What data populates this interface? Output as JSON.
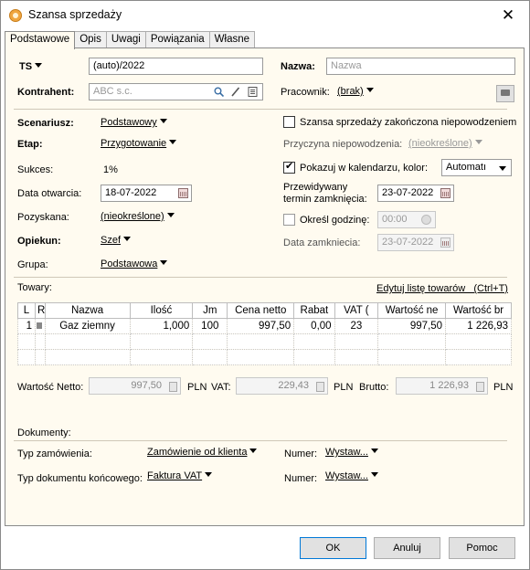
{
  "window": {
    "title": "Szansa sprzedaży",
    "close": "✕"
  },
  "tabs": [
    "Podstawowe",
    "Opis",
    "Uwagi",
    "Powiązania",
    "Własne"
  ],
  "header": {
    "ts_label": "TS",
    "ts_value": "(auto)/2022",
    "nazwa_label": "Nazwa:",
    "nazwa_placeholder": "Nazwa",
    "kontrahent_label": "Kontrahent:",
    "kontrahent_placeholder": "ABC s.c.",
    "pracownik_label": "Pracownik:",
    "pracownik_value": "(brak)"
  },
  "left": {
    "scenariusz_label": "Scenariusz:",
    "scenariusz_value": "Podstawowy",
    "etap_label": "Etap:",
    "etap_value": "Przygotowanie",
    "sukces_label": "Sukces:",
    "sukces_value": "1%",
    "data_otwarcia_label": "Data otwarcia:",
    "data_otwarcia_value": "18-07-2022",
    "pozyskana_label": "Pozyskana:",
    "pozyskana_value": "(nieokreślone)",
    "opiekun_label": "Opiekun:",
    "opiekun_value": "Szef",
    "grupa_label": "Grupa:",
    "grupa_value": "Podstawowa"
  },
  "right": {
    "zakonczona_label": "Szansa sprzedaży zakończona niepowodzeniem",
    "przyczyna_label": "Przyczyna niepowodzenia:",
    "przyczyna_value": "(nieokreślone)",
    "kalendarz_label": "Pokazuj w kalendarzu, kolor:",
    "kolor_value": "Automatı",
    "przewidywany_label_1": "Przewidywany",
    "przewidywany_label_2": "termin zamknięcia:",
    "przewidywany_value": "23-07-2022",
    "godzine_label": "Określ godzinę:",
    "godzine_value": "00:00",
    "data_zamkniecia_label": "Data zamkniecia:",
    "data_zamkniecia_value": "23-07-2022"
  },
  "towary": {
    "label": "Towary:",
    "edit_link": "Edytuj listę towarów   (Ctrl+T)",
    "columns": [
      "L",
      "R",
      "Nazwa",
      "Ilość",
      "Jm",
      "Cena netto",
      "Rabat",
      "VAT (",
      "Wartość ne",
      "Wartość br"
    ],
    "rows": [
      [
        "1",
        "",
        "Gaz ziemny",
        "1,000",
        "100",
        "997,50",
        "0,00",
        "23",
        "997,50",
        "1 226,93"
      ]
    ]
  },
  "totals": {
    "netto_label": "Wartość Netto:",
    "netto_value": "997,50",
    "vat_label": "VAT:",
    "vat_value": "229,43",
    "brutto_label": "Brutto:",
    "brutto_value": "1 226,93",
    "currency": "PLN"
  },
  "dokumenty": {
    "label": "Dokumenty:",
    "typ_zamowienia_label": "Typ zamówienia:",
    "typ_zamowienia_value": "Zamówienie od klienta",
    "numer_label": "Numer:",
    "numer_value": "Wystaw...",
    "typ_koncowego_label": "Typ dokumentu końcowego:",
    "typ_koncowego_value": "Faktura VAT"
  },
  "buttons": {
    "ok": "OK",
    "anuluj": "Anuluj",
    "pomoc": "Pomoc"
  }
}
